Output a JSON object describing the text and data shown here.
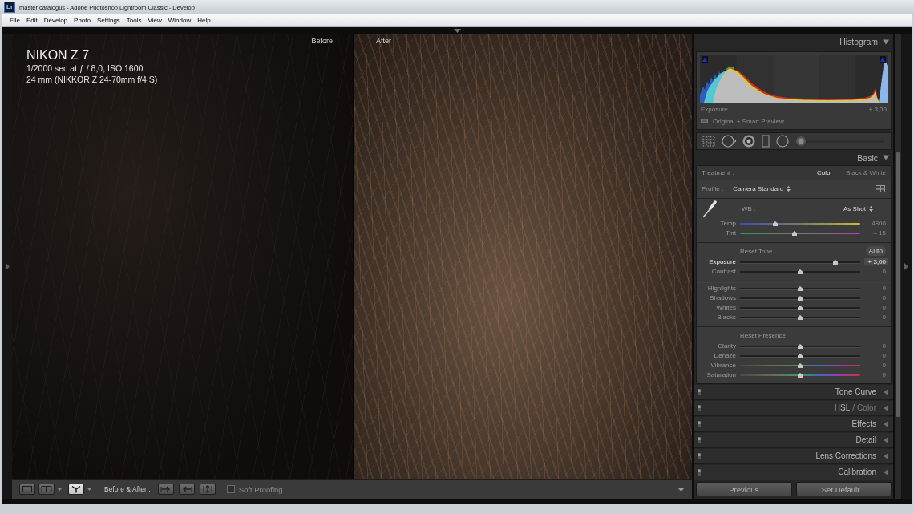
{
  "window": {
    "app_icon": "Lr",
    "title": "master catalogus - Adobe Photoshop Lightroom Classic - Develop"
  },
  "menu": [
    "File",
    "Edit",
    "Develop",
    "Photo",
    "Settings",
    "Tools",
    "View",
    "Window",
    "Help"
  ],
  "preview": {
    "before_label": "Before",
    "after_label": "After",
    "info": {
      "camera": "NIKON Z 7",
      "exposure": "1/2000 sec at ƒ / 8,0, ISO 1600",
      "lens": "24 mm (NIKKOR Z 24-70mm f/4 S)"
    }
  },
  "toolbar": {
    "view_modes": [
      {
        "selected": false
      },
      {
        "selected": false
      },
      {
        "selected": true
      }
    ],
    "label": "Before & After :",
    "soft_proofing": {
      "label": "Soft Proofing",
      "checked": false
    }
  },
  "histogram": {
    "title": "Histogram",
    "reading_label": "Exposure",
    "reading_value": "+ 3,00",
    "preview_status": "Original + Smart Preview"
  },
  "basic": {
    "title": "Basic",
    "treatment": {
      "label": "Treatment :",
      "options": [
        {
          "label": "Color",
          "selected": true
        },
        {
          "label": "Black & White",
          "selected": false
        }
      ]
    },
    "profile": {
      "label": "Profile :",
      "value": "Camera Standard"
    },
    "white_balance": {
      "label": "WB :",
      "value": "As Shot",
      "sliders": [
        {
          "label": "Temp",
          "value": "4800",
          "level": 0.29,
          "kind": "temp",
          "selected": false
        },
        {
          "label": "Tint",
          "value": "– 15",
          "level": 0.45,
          "kind": "tint",
          "selected": false
        }
      ]
    },
    "tone": {
      "heading": "Reset Tone",
      "button": "Auto",
      "groups": [
        {
          "sliders": [
            {
              "label": "Exposure",
              "value": "+ 3,00",
              "level": 0.79,
              "kind": "plain",
              "selected": true
            },
            {
              "label": "Contrast",
              "value": "0",
              "level": 0.5,
              "kind": "plain",
              "selected": false
            }
          ]
        },
        {
          "sliders": [
            {
              "label": "Highlights",
              "value": "0",
              "level": 0.5,
              "kind": "plain",
              "selected": false
            },
            {
              "label": "Shadows",
              "value": "0",
              "level": 0.5,
              "kind": "plain",
              "selected": false
            },
            {
              "label": "Whites",
              "value": "0",
              "level": 0.5,
              "kind": "plain",
              "selected": false
            },
            {
              "label": "Blacks",
              "value": "0",
              "level": 0.5,
              "kind": "plain",
              "selected": false
            }
          ]
        }
      ]
    },
    "presence": {
      "heading": "Reset Presence",
      "sliders": [
        {
          "label": "Clarity",
          "value": "0",
          "level": 0.5,
          "kind": "plain",
          "selected": false
        },
        {
          "label": "Dehaze",
          "value": "0",
          "level": 0.5,
          "kind": "plain",
          "selected": false
        },
        {
          "label": "Vibrance",
          "value": "0",
          "level": 0.5,
          "kind": "spectrum",
          "selected": false
        },
        {
          "label": "Saturation",
          "value": "0",
          "level": 0.5,
          "kind": "spectrum",
          "selected": false
        }
      ]
    }
  },
  "panels": [
    {
      "kind": "plain",
      "title": "Tone Curve"
    },
    {
      "kind": "tabs",
      "separator": "/",
      "tabs": [
        {
          "label": "HSL",
          "selected": true
        },
        {
          "label": "Color",
          "selected": false
        }
      ]
    },
    {
      "kind": "plain",
      "title": "Effects"
    },
    {
      "kind": "plain",
      "title": "Detail"
    },
    {
      "kind": "plain",
      "title": "Lens Corrections"
    },
    {
      "kind": "plain",
      "title": "Calibration"
    }
  ],
  "buttons": [
    "Previous",
    "Set Default..."
  ]
}
